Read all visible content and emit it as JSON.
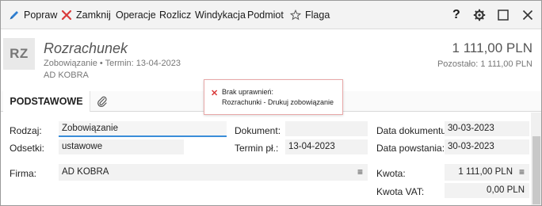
{
  "toolbar": {
    "items": [
      {
        "label": "Popraw",
        "icon": "pencil-icon"
      },
      {
        "label": "Zamknij",
        "icon": "close-x-icon"
      },
      {
        "label": "Operacje"
      },
      {
        "label": "Rozlicz"
      },
      {
        "label": "Windykacja"
      },
      {
        "label": "Podmiot"
      },
      {
        "label": "Flaga",
        "icon": "star-icon"
      }
    ],
    "window_controls": [
      "help-icon",
      "settings-gear-icon",
      "maximize-icon",
      "close-window-icon"
    ],
    "help_label": "?"
  },
  "header": {
    "badge": "RZ",
    "title": "Rozrachunek",
    "subtitle": "Zobowiązanie  •  Termin: 13-04-2023",
    "contractor": "AD KOBRA",
    "amount": "1 111,00 PLN",
    "remaining": "Pozostało: 1 111,00 PLN"
  },
  "tabs": {
    "active": "PODSTAWOWE",
    "attachment_icon": "paperclip-icon"
  },
  "error_popup": {
    "line1": "Brak uprawnień:",
    "line2": "Rozrachunki - Drukuj zobowiązanie",
    "icon": "error-x-icon",
    "color": "#d93a3a"
  },
  "form": {
    "rodzaj_label": "Rodzaj:",
    "rodzaj_value": "Zobowiązanie",
    "odsetki_label": "Odsetki:",
    "odsetki_value": "ustawowe",
    "dokument_label": "Dokument:",
    "dokument_value": "",
    "termin_label": "Termin pł.:",
    "termin_value": "13-04-2023",
    "data_dok_label": "Data dokumentu:",
    "data_dok_value": "30-03-2023",
    "data_pow_label": "Data powstania:",
    "data_pow_value": "30-03-2023",
    "firma_label": "Firma:",
    "firma_value": "AD KOBRA",
    "kwota_label": "Kwota:",
    "kwota_value": "1 111,00 PLN",
    "kwota_vat_label": "Kwota VAT:",
    "kwota_vat_value": "0,00 PLN",
    "menu_glyph": "≡"
  },
  "colors": {
    "accent": "#3a8dd9",
    "pencil": "#2f7fd1",
    "close_red": "#d93a3a"
  }
}
